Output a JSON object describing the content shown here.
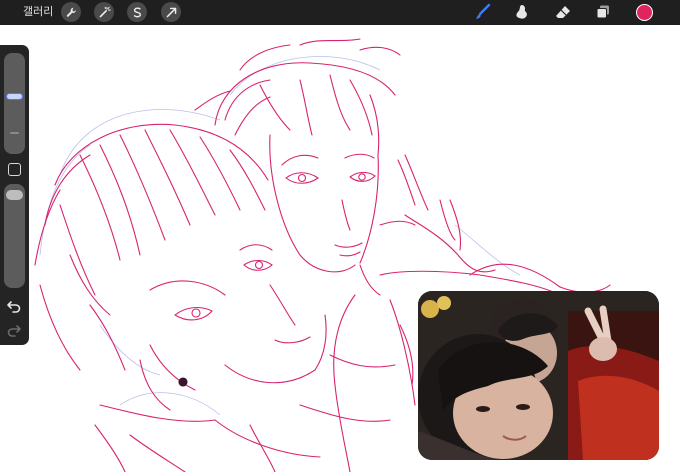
{
  "app": {
    "gallery_label": "갤러리"
  },
  "toolbar": {
    "actions": [
      {
        "icon": "wrench-icon"
      },
      {
        "icon": "magic-wand-icon"
      },
      {
        "icon": "selection-icon"
      },
      {
        "icon": "transform-arrow-icon"
      }
    ],
    "tools": [
      {
        "icon": "brush-icon",
        "active": true,
        "color": "#3d7bf7"
      },
      {
        "icon": "smudge-icon",
        "active": false,
        "color": "#e6e6e6"
      },
      {
        "icon": "eraser-icon",
        "active": false,
        "color": "#e6e6e6"
      },
      {
        "icon": "layers-icon",
        "active": false,
        "color": "#e6e6e6"
      }
    ],
    "current_color": "#e0245e"
  },
  "sidebar": {
    "brush_size": 0.57,
    "opacity": 0.06,
    "accent": "#5b74e8"
  },
  "canvas": {
    "line_color": "#d8246e",
    "sketch_color": "#9aa6e8",
    "content": "sketch-artwork"
  },
  "reference_photo": {
    "content": "reference-photo"
  }
}
